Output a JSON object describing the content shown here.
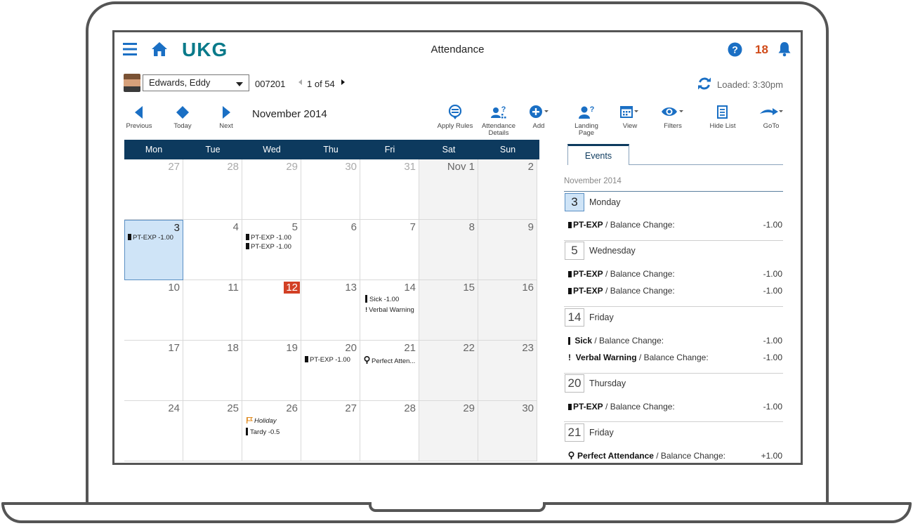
{
  "app": {
    "logo": "UKG",
    "title": "Attendance",
    "notification_count": "18"
  },
  "employee": {
    "name": "Edwards, Eddy",
    "id": "007201",
    "position": "1 of 54",
    "loaded": "Loaded: 3:30pm"
  },
  "toolbar": {
    "previous": "Previous",
    "today": "Today",
    "next": "Next",
    "month": "November 2014",
    "apply_rules": "Apply Rules",
    "attendance_details_1": "Attendance",
    "attendance_details_2": "Details",
    "add": "Add",
    "landing_page_1": "Landing",
    "landing_page_2": "Page",
    "view": "View",
    "filters": "Filters",
    "hide_list": "Hide List",
    "goto": "GoTo"
  },
  "calendar": {
    "weekdays": [
      "Mon",
      "Tue",
      "Wed",
      "Thu",
      "Fri",
      "Sat",
      "Sun"
    ],
    "weeks": [
      [
        {
          "d": "27",
          "s": "muted"
        },
        {
          "d": "28",
          "s": "muted"
        },
        {
          "d": "29",
          "s": "muted"
        },
        {
          "d": "30",
          "s": "muted"
        },
        {
          "d": "31",
          "s": "muted"
        },
        {
          "d": "Nov 1",
          "s": ""
        },
        {
          "d": "2",
          "s": ""
        }
      ],
      [
        {
          "d": "3",
          "s": "selected"
        },
        {
          "d": "4",
          "s": ""
        },
        {
          "d": "5",
          "s": ""
        },
        {
          "d": "6",
          "s": ""
        },
        {
          "d": "7",
          "s": ""
        },
        {
          "d": "8",
          "s": ""
        },
        {
          "d": "9",
          "s": ""
        }
      ],
      [
        {
          "d": "10",
          "s": ""
        },
        {
          "d": "11",
          "s": ""
        },
        {
          "d": "12",
          "s": "today"
        },
        {
          "d": "13",
          "s": ""
        },
        {
          "d": "14",
          "s": ""
        },
        {
          "d": "15",
          "s": ""
        },
        {
          "d": "16",
          "s": ""
        }
      ],
      [
        {
          "d": "17",
          "s": ""
        },
        {
          "d": "18",
          "s": ""
        },
        {
          "d": "19",
          "s": ""
        },
        {
          "d": "20",
          "s": ""
        },
        {
          "d": "21",
          "s": ""
        },
        {
          "d": "22",
          "s": ""
        },
        {
          "d": "23",
          "s": ""
        }
      ],
      [
        {
          "d": "24",
          "s": ""
        },
        {
          "d": "25",
          "s": ""
        },
        {
          "d": "26",
          "s": ""
        },
        {
          "d": "27",
          "s": ""
        },
        {
          "d": "28",
          "s": ""
        },
        {
          "d": "29",
          "s": ""
        },
        {
          "d": "30",
          "s": ""
        }
      ]
    ],
    "events": {
      "nov3_a": "PT-EXP -1.00",
      "nov5_a": "PT-EXP -1.00",
      "nov5_b": "PT-EXP -1.00",
      "nov14_a": "Sick -1.00",
      "nov14_b": "Verbal Warning",
      "nov20_a": "PT-EXP -1.00",
      "nov21_a": "Perfect Atten...",
      "nov26_a": "Holiday",
      "nov26_b": "Tardy -0.5"
    }
  },
  "events_panel": {
    "tab": "Events",
    "month": "November 2014",
    "days": {
      "d3_num": "3",
      "d3_name": "Monday",
      "d5_num": "5",
      "d5_name": "Wednesday",
      "d14_num": "14",
      "d14_name": "Friday",
      "d20_num": "20",
      "d20_name": "Thursday",
      "d21_num": "21",
      "d21_name": "Friday"
    },
    "items": {
      "e1_code": "PT-EXP",
      "e1_rest": " / Balance Change:",
      "e1_amt": "-1.00",
      "e2_code": "PT-EXP",
      "e2_rest": " / Balance Change:",
      "e2_amt": "-1.00",
      "e3_code": "PT-EXP",
      "e3_rest": " / Balance Change:",
      "e3_amt": "-1.00",
      "e4_code": "Sick",
      "e4_rest": " / Balance Change:",
      "e4_amt": "-1.00",
      "e5_code": "Verbal Warning",
      "e5_rest": " / Balance Change:",
      "e5_amt": "-1.00",
      "e6_code": "PT-EXP",
      "e6_rest": " / Balance Change:",
      "e6_amt": "-1.00",
      "e7_code": "Perfect Attendance",
      "e7_rest": " / Balance Change:",
      "e7_amt": "+1.00"
    }
  },
  "colors": {
    "header_navy": "#0d3a5e",
    "accent_blue": "#1a6fc4",
    "today_red": "#d24025",
    "notification_orange": "#d04a18",
    "selected_blue": "#cfe4f7",
    "logo_teal": "#0a7a8a"
  }
}
